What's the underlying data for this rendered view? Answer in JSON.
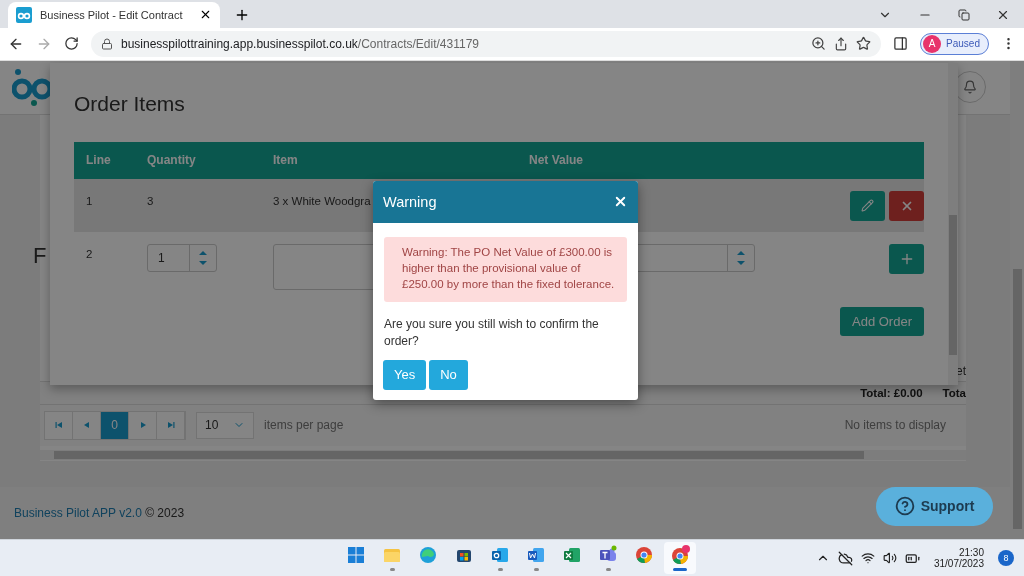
{
  "browser": {
    "tab_title": "Business Pilot - Edit Contract",
    "url_domain": "businesspilottraining.app.businesspilot.co.uk",
    "url_path": "/Contracts/Edit/431179",
    "profile_initial": "A",
    "profile_status": "Paused"
  },
  "page": {
    "heading_fragment": "F",
    "totals": [
      "Total: £0.00",
      "Tota"
    ],
    "column_fragment": "et",
    "pager": {
      "pages": [
        {
          "label": "0",
          "selected": true
        }
      ],
      "page_size": "10",
      "page_size_label": "items per page",
      "status": "No items to display"
    },
    "footer": {
      "link": "Business Pilot APP v2.0",
      "text": " © 2023"
    },
    "support": "Support"
  },
  "order_modal": {
    "title": "Order Items",
    "columns": [
      "Line",
      "Quantity",
      "Item",
      "Net Value"
    ],
    "rows": [
      {
        "kind": "saved",
        "line": "1",
        "quantity": "3",
        "item": "3 x White Woodgra"
      },
      {
        "kind": "new",
        "line": "2",
        "quantity": "1"
      }
    ],
    "add_button": "Add Order"
  },
  "warning": {
    "title": "Warning",
    "alert": "Warning: The PO Net Value of £300.00 is higher than the provisional value of £250.00 by more than the fixed tolerance.",
    "question": "Are you sure you still wish to confirm the order?",
    "buttons": [
      "Yes",
      "No"
    ]
  },
  "taskbar": {
    "apps": [
      {
        "kind": "start",
        "running": false,
        "selected": false
      },
      {
        "kind": "folder",
        "running": true,
        "selected": false
      },
      {
        "kind": "edge",
        "running": false,
        "selected": false
      },
      {
        "kind": "store",
        "running": false,
        "selected": false
      },
      {
        "kind": "outlook",
        "running": true,
        "selected": false
      },
      {
        "kind": "word",
        "running": true,
        "selected": false
      },
      {
        "kind": "excel",
        "running": false,
        "selected": false
      },
      {
        "kind": "teams",
        "running": true,
        "selected": false
      },
      {
        "kind": "chrome",
        "running": false,
        "selected": false
      },
      {
        "kind": "chrome-profile",
        "running": true,
        "selected": true
      }
    ],
    "time": "21:30",
    "date": "31/07/2023",
    "notifications": "8"
  }
}
